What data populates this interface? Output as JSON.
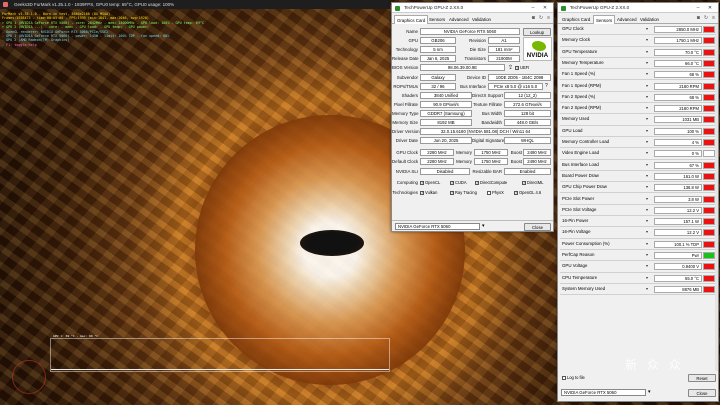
{
  "fm": {
    "title": "Geeks3D FurMark v1.35.1.0 - 1939FPS, GPU0 temp: 69°C, GPU0 usage: 100%",
    "lines": [
      {
        "text": "FurMark v1.35.1.0 - Burn-in test, 3840x2160 (8X MSAA)",
        "style": ""
      },
      {
        "text": "Frames:1938473 - time:00:05:00 - FPS:1939 (min:1841, max:2046, avg:1928)",
        "style": ""
      },
      {
        "text": "> GPU 1 (NVIDIA GeForce RTX 5060) - core: 2842MHz - mem: 14000MHz - GPU load: 100% - GPU temp: 69°C",
        "style": "green"
      },
      {
        "text": "> GPU 2 (NVIDIA ...) - core:  - mem:  - GPU load:  - GPU temp:  - GPU power: ",
        "style": "green"
      },
      {
        "text": "- OpenGL renderer: NVIDIA GeForce RTX 5060/PCIe/SSE2",
        "style": "cyan"
      },
      {
        "text": "- GPU 1 (NVIDIA GeForce RTX 5060) - power: 145W - limit: 100% TDP - fan speed: 68%",
        "style": "cyan"
      },
      {
        "text": "- GPU 2 (AMD Radeon(TM) Graphics)",
        "style": "cyan"
      },
      {
        "text": "- F1: toggle help",
        "style": "pink"
      }
    ],
    "graph_label": "GPU 1: 69 °C - max: 69 °C"
  },
  "gc": {
    "title": "TechPowerUp GPU-Z 2.XX.0",
    "tabs": [
      "Graphics Card",
      "Sensors",
      "Advanced",
      "Validation"
    ],
    "lookup": "Lookup",
    "name": "NVIDIA GeForce RTX 5060",
    "gpu": "GB206",
    "revision": "A1",
    "technology": "5 nm",
    "die_size": "181 mm²",
    "release_date": "Jan 6, 2025",
    "transistors": "21900M",
    "bios": "98.06.39.00.9E",
    "uefi": "UEFI",
    "subvendor": "Galaxy",
    "device_id": "10DE 2D05 - 1B4C 2098",
    "rops": "32 / 96",
    "bus_interface": "PCIe x8 5.0 @ x16 5.0",
    "shaders": "3840 Unified",
    "directx": "12 (12_2)",
    "pixel_fillrate": "90.9 GPixel/s",
    "texture_fillrate": "272.6 GTexel/s",
    "memory_type": "GDDR7 (Samsung)",
    "bus_width": "128 bit",
    "memory_size": "8192 MB",
    "bandwidth": "448.0 GB/s",
    "driver_version": "32.0.15.6180 (NVIDIA 581.08) DCH / Win11 64",
    "driver_date": "Jun 20, 2025",
    "digital_signature": "WHQL",
    "gpu_clock": "2280 MHz",
    "memory_clock": "1750 MHz",
    "boost": "2490 MHz",
    "default_clock": "2280 MHz",
    "default_memory": "1750 MHz",
    "default_boost": "2490 MHz",
    "nvidia_sli": "Disabled",
    "resizable_bar": "Enabled",
    "computing": [
      "OpenCL",
      "CUDA",
      "DirectCompute",
      "DirectML"
    ],
    "technologies": [
      "Vulkan",
      "Ray Tracing",
      "PhysX",
      "OpenGL 4.6"
    ],
    "labels": {
      "name": "Name",
      "gpu": "GPU",
      "revision": "Revision",
      "technology": "Technology",
      "die_size": "Die Size",
      "release_date": "Release Date",
      "transistors": "Transistors",
      "bios": "BIOS Version",
      "subvendor": "Subvendor",
      "device_id": "Device ID",
      "rops": "ROPs/TMUs",
      "bus_interface": "Bus Interface",
      "shaders": "Shaders",
      "directx": "DirectX Support",
      "pixel_fillrate": "Pixel Fillrate",
      "texture_fillrate": "Texture Fillrate",
      "memory_type": "Memory Type",
      "bus_width": "Bus Width",
      "memory_size": "Memory Size",
      "bandwidth": "Bandwidth",
      "driver_version": "Driver Version",
      "driver_date": "Driver Date",
      "digital_signature": "Digital Signature",
      "gpu_clock": "GPU Clock",
      "memory": "Memory",
      "boost": "Boost",
      "default_clock": "Default Clock",
      "nvidia_sli": "NVIDIA SLI",
      "resizable_bar": "Resizable BAR",
      "computing": "Computing",
      "technologies": "Technologies"
    },
    "selected_card": "NVIDIA GeForce RTX 5060",
    "close": "Close",
    "nvidia_brand": "NVIDIA"
  },
  "sensors": {
    "title": "TechPowerUp GPU-Z 2.XX.0",
    "tabs": [
      "Graphics Card",
      "Sensors",
      "Advanced",
      "Validation"
    ],
    "rows": [
      {
        "name": "GPU Clock",
        "value": "2850.0 MHz",
        "fill": 0.95,
        "color": "#ee1111"
      },
      {
        "name": "Memory Clock",
        "value": "1750.1 MHz",
        "fill": 0.95,
        "color": "#ee1111"
      },
      {
        "name": "GPU Temperature",
        "value": "70.0 °C",
        "fill": 0.95,
        "color": "#ee1111"
      },
      {
        "name": "Memory Temperature",
        "value": "66.0 °C",
        "fill": 0.95,
        "color": "#ee1111"
      },
      {
        "name": "Fan 1 Speed (%)",
        "value": "68 %",
        "fill": 0.95,
        "color": "#ee1111"
      },
      {
        "name": "Fan 1 Speed (RPM)",
        "value": "2180 RPM",
        "fill": 0.95,
        "color": "#ee1111"
      },
      {
        "name": "Fan 2 Speed (%)",
        "value": "68 %",
        "fill": 0.95,
        "color": "#ee1111"
      },
      {
        "name": "Fan 2 Speed (RPM)",
        "value": "2180 RPM",
        "fill": 0.95,
        "color": "#ee1111"
      },
      {
        "name": "Memory Used",
        "value": "1031 MB",
        "fill": 0.95,
        "color": "#ee1111"
      },
      {
        "name": "GPU Load",
        "value": "100 %",
        "fill": 0.95,
        "color": "#ee1111"
      },
      {
        "name": "Memory Controller Load",
        "value": "4 %",
        "fill": 0.95,
        "color": "#ee1111"
      },
      {
        "name": "Video Engine Load",
        "value": "0 %",
        "fill": 0.0,
        "color": "#ee1111"
      },
      {
        "name": "Bus Interface Load",
        "value": "67 %",
        "fill": 0.95,
        "color": "#ee1111"
      },
      {
        "name": "Board Power Draw",
        "value": "161.0 W",
        "fill": 0.95,
        "color": "#ee1111"
      },
      {
        "name": "GPU Chip Power Draw",
        "value": "136.8 W",
        "fill": 0.95,
        "color": "#ee1111"
      },
      {
        "name": "PCIe Slot Power",
        "value": "3.8 W",
        "fill": 0.95,
        "color": "#ee1111"
      },
      {
        "name": "PCIe Slot Voltage",
        "value": "12.2 V",
        "fill": 0.95,
        "color": "#ee1111"
      },
      {
        "name": "16-Pin Power",
        "value": "157.1 W",
        "fill": 0.95,
        "color": "#ee1111"
      },
      {
        "name": "16-Pin Voltage",
        "value": "12.2 V",
        "fill": 0.95,
        "color": "#ee1111"
      },
      {
        "name": "Power Consumption (%)",
        "value": "100.1 % TDP",
        "fill": 0.95,
        "color": "#ee1111"
      },
      {
        "name": "PerfCap Reason",
        "value": "Pwr",
        "fill": 1.0,
        "color": "#19c219"
      },
      {
        "name": "GPU Voltage",
        "value": "0.9400 V",
        "fill": 0.95,
        "color": "#ee1111"
      },
      {
        "name": "CPU Temperature",
        "value": "55.0 °C",
        "fill": 0.95,
        "color": "#ee1111"
      },
      {
        "name": "System Memory Used",
        "value": "8876 MB",
        "fill": 0.95,
        "color": "#ee1111"
      }
    ],
    "log_to_file": "Log to file",
    "reset": "Reset",
    "selected_card": "NVIDIA GeForce RTX 5060",
    "close": "Close"
  },
  "watermark": "新 众 众"
}
